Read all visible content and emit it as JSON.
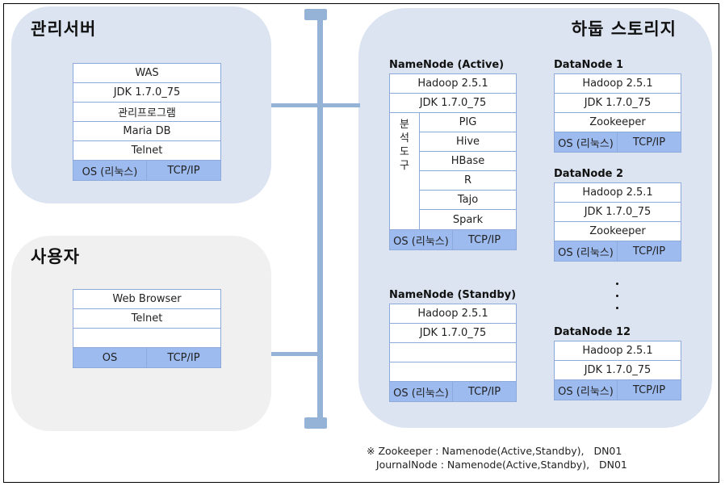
{
  "colors": {
    "zone_blue": "#dbe4f0",
    "zone_gray": "#f0f0f0",
    "bus": "#95b3d7",
    "stack_border": "#8eaadb",
    "base_fill": "#9dbbef"
  },
  "admin": {
    "title": "관리서버",
    "rows": [
      "WAS",
      "JDK 1.7.0_75",
      "관리프로그램",
      "Maria DB",
      "Telnet"
    ],
    "os": "OS (리눅스)",
    "net": "TCP/IP"
  },
  "user": {
    "title": "사용자",
    "rows": [
      "Web Browser",
      "Telnet",
      ""
    ],
    "os": "OS",
    "net": "TCP/IP"
  },
  "hadoop": {
    "title": "하둡 스토리지",
    "nn_active": {
      "title": "NameNode  (Active)",
      "rows": [
        "Hadoop 2.5.1",
        "JDK 1.7.0_75"
      ],
      "tools_label": [
        "분",
        "석",
        "도",
        "구"
      ],
      "tools": [
        "PIG",
        "Hive",
        "HBase",
        "R",
        "Tajo",
        "Spark"
      ],
      "os": "OS (리눅스)",
      "net": "TCP/IP"
    },
    "nn_standby": {
      "title": "NameNode  (Standby)",
      "rows": [
        "Hadoop 2.5.1",
        "JDK 1.7.0_75",
        "",
        ""
      ],
      "os": "OS (리눅스)",
      "net": "TCP/IP"
    },
    "dn1": {
      "title": "DataNode  1",
      "rows": [
        "Hadoop 2.5.1",
        "JDK 1.7.0_75",
        "Zookeeper"
      ],
      "os": "OS (리눅스)",
      "net": "TCP/IP"
    },
    "dn2": {
      "title": "DataNode  2",
      "rows": [
        "Hadoop 2.5.1",
        "JDK 1.7.0_75",
        "Zookeeper"
      ],
      "os": "OS (리눅스)",
      "net": "TCP/IP"
    },
    "dn12": {
      "title": "DataNode  12",
      "rows": [
        "Hadoop 2.5.1",
        "JDK 1.7.0_75"
      ],
      "os": "OS (리눅스)",
      "net": "TCP/IP"
    }
  },
  "note": {
    "line1": "※ Zookeeper : Namenode(Active,Standby),   DN01",
    "line2": "   JournalNode : Namenode(Active,Standby),   DN01"
  }
}
